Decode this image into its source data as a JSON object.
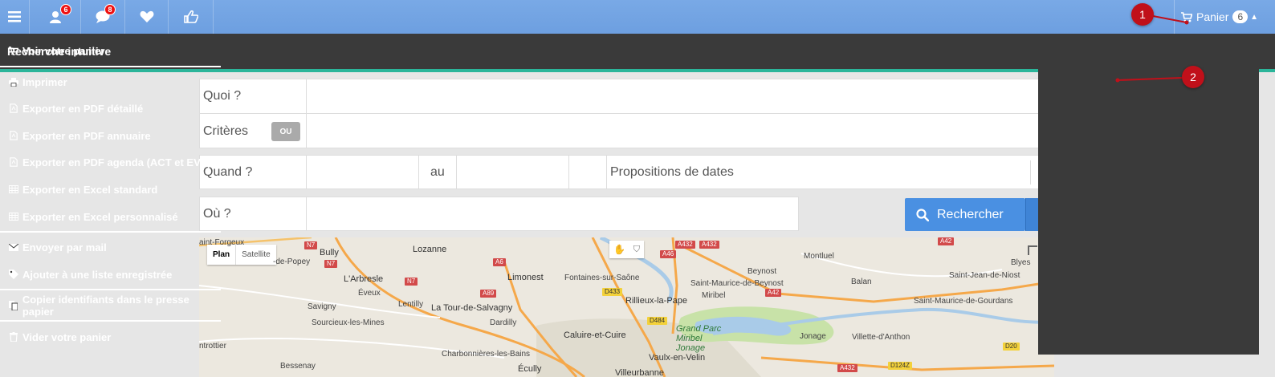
{
  "topbar": {
    "badges": {
      "users": "6",
      "messages": "8"
    },
    "cart": {
      "label": "Panier",
      "count": "6"
    }
  },
  "header": {
    "title": "Recherche intuitive"
  },
  "form": {
    "quoi_label": "Quoi ?",
    "criteres_label": "Critères",
    "ou_toggle": "OU",
    "quand_label": "Quand ?",
    "au_label": "au",
    "propositions_label": "Propositions de dates",
    "ou_label": "Où ?",
    "search_button": "Rechercher"
  },
  "map": {
    "types": {
      "plan": "Plan",
      "satellite": "Satellite"
    },
    "places": [
      {
        "name": "aint-Forgeux"
      },
      {
        "name": "-de-Popey"
      },
      {
        "name": "Bully"
      },
      {
        "name": "Lozanne"
      },
      {
        "name": "L'Arbresle"
      },
      {
        "name": "Éveux"
      },
      {
        "name": "Limonest"
      },
      {
        "name": "Fontaines-sur-Saône"
      },
      {
        "name": "Lentilly"
      },
      {
        "name": "La Tour-de-Salvagny"
      },
      {
        "name": "Savigny"
      },
      {
        "name": "Sourcieux-les-Mines"
      },
      {
        "name": "Dardilly"
      },
      {
        "name": "Rillieux-la-Pape"
      },
      {
        "name": "Caluire-et-Cuire"
      },
      {
        "name": "ntrottier"
      },
      {
        "name": "Charbonnières-les-Bains"
      },
      {
        "name": "Vaulx-en-Velin"
      },
      {
        "name": "Bessenay"
      },
      {
        "name": "Écully"
      },
      {
        "name": "Villeurbanne"
      },
      {
        "name": "Montluel"
      },
      {
        "name": "Beynost"
      },
      {
        "name": "Saint-Maurice-de-Beynost"
      },
      {
        "name": "Miribel"
      },
      {
        "name": "Balan"
      },
      {
        "name": "Saint-Jean-de-Niost"
      },
      {
        "name": "Saint-Maurice-de-Gourdans"
      },
      {
        "name": "Jonage"
      },
      {
        "name": "Villette-d'Anthon"
      },
      {
        "name": "Blyes"
      }
    ],
    "park": "Grand Parc Miribel Jonage",
    "roads": [
      "N7",
      "N7",
      "N7",
      "A6",
      "A89",
      "A46",
      "A432",
      "A432",
      "D433",
      "D484",
      "A42",
      "A42",
      "D20",
      "D124Z",
      "A432"
    ]
  },
  "cart_menu": {
    "items": [
      {
        "label": "Voir votre panier",
        "icon": "cart-icon"
      },
      {
        "label": "Imprimer",
        "icon": "print-icon"
      },
      {
        "label": "Exporter en PDF détaillé",
        "icon": "pdf-icon"
      },
      {
        "label": "Exporter en PDF annuaire",
        "icon": "pdf-icon"
      },
      {
        "label": "Exporter en PDF agenda (ACT et EVE)",
        "icon": "pdf-icon"
      },
      {
        "label": "Exporter en Excel standard",
        "icon": "table-icon"
      },
      {
        "label": "Exporter en Excel personnalisé",
        "icon": "table-icon"
      },
      {
        "label": "Envoyer par mail",
        "icon": "envelope-icon"
      },
      {
        "label": "Ajouter à une liste enregistrée",
        "icon": "tag-icon"
      },
      {
        "label": "Copier identifiants dans le presse papier",
        "icon": "copy-icon"
      },
      {
        "label": "Vider votre panier",
        "icon": "trash-icon"
      }
    ]
  },
  "annotations": {
    "step1": "1",
    "step2": "2"
  },
  "colors": {
    "topbar": "#6d9fe0",
    "header": "#3a3a3a",
    "accent": "#2bb59a",
    "search_button": "#4a90e2",
    "marker": "#c0101a"
  }
}
